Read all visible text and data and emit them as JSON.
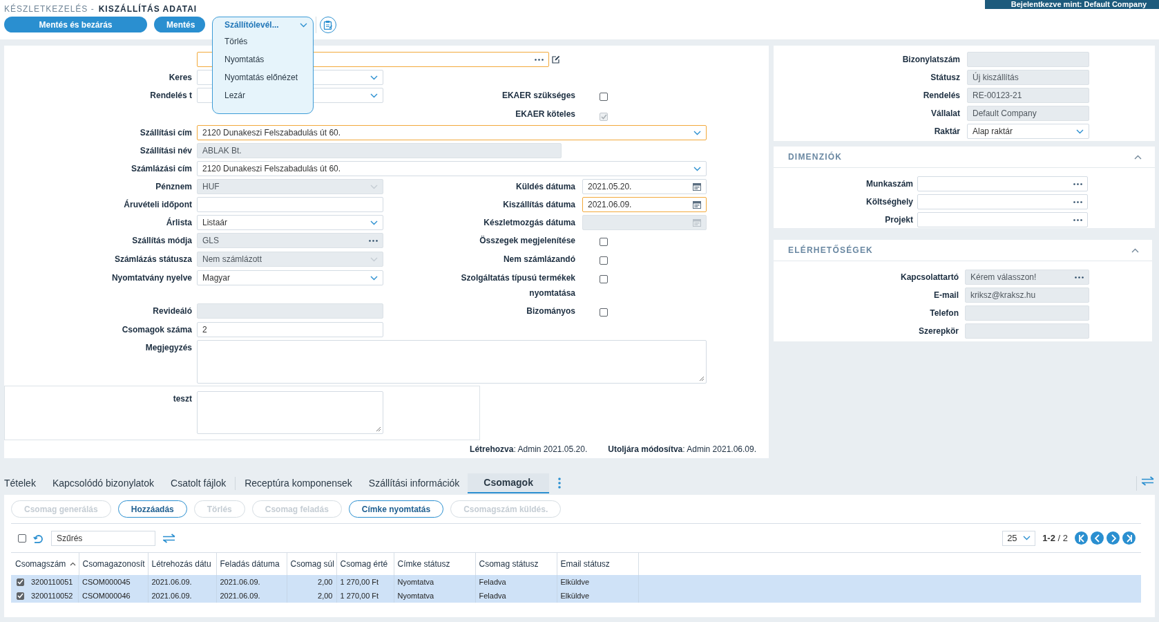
{
  "header": {
    "breadcrumb": "KÉSZLETKEZELÉS -",
    "title": "KISZÁLLÍTÁS ADATAI",
    "login": "Bejelentkezve mint: Default Company"
  },
  "toolbar": {
    "buttons": [
      "Mentés és bezárás",
      "Mentés"
    ],
    "dropdown": {
      "label": "Szállítólevél...",
      "expanded": true,
      "items": [
        "Törlés",
        "Nyomtatás",
        "Nyomtatás előnézet",
        "Lezár"
      ]
    }
  },
  "form": {
    "rows": [
      {
        "full": {
          "kind": "lookup",
          "disabled": false,
          "focused": true,
          "editable": true
        }
      },
      {
        "left": {
          "label": "Keres",
          "kind": "select",
          "disabled": false
        }
      },
      {
        "left": {
          "label": "Rendelés t",
          "kind": "select",
          "disabled": false
        },
        "right": {
          "label": "EKAER szükséges",
          "kind": "checkbox",
          "checked": false,
          "disabled": false
        }
      },
      {
        "right": {
          "label": "EKAER köteles",
          "kind": "checkbox",
          "checked": true,
          "disabled": true
        }
      },
      {
        "full": {
          "label": "Szállítási cím",
          "kind": "select",
          "value": "2120 Dunakeszi Felszabadulás út 60.",
          "disabled": false,
          "focused": true
        }
      },
      {
        "full": {
          "label": "Szállítási név",
          "kind": "text",
          "value": "ABLAK Bt.",
          "disabled": true
        }
      },
      {
        "full": {
          "label": "Számlázási cím",
          "kind": "select",
          "value": "2120 Dunakeszi Felszabadulás út 60.",
          "disabled": false
        }
      },
      {
        "left": {
          "label": "Pénznem",
          "kind": "select",
          "value": "HUF",
          "disabled": true
        },
        "right": {
          "label": "Küldés dátuma",
          "kind": "date",
          "value": "2021.05.20.",
          "disabled": false
        }
      },
      {
        "left": {
          "label": "Áruvételi időpont",
          "kind": "text",
          "disabled": false
        },
        "right": {
          "label": "Kiszállítás dátuma",
          "kind": "date",
          "value": "2021.06.09.",
          "disabled": false,
          "focused": true
        }
      },
      {
        "left": {
          "label": "Árlista",
          "kind": "select",
          "value": "Listaár",
          "disabled": false
        },
        "right": {
          "label": "Készletmozgás dátuma",
          "kind": "date",
          "disabled": true
        }
      },
      {
        "left": {
          "label": "Szállítás módja",
          "kind": "lookup",
          "value": "GLS",
          "disabled": true
        },
        "right": {
          "label": "Összegek megjelenítése",
          "kind": "checkbox",
          "checked": false,
          "disabled": false
        }
      },
      {
        "left": {
          "label": "Számlázás státusza",
          "kind": "select",
          "value": "Nem számlázott",
          "disabled": true
        },
        "right": {
          "label": "Nem számlázandó",
          "kind": "checkbox",
          "checked": false,
          "disabled": false
        }
      },
      {
        "left": {
          "label": "Nyomtatvány nyelve",
          "kind": "select",
          "value": "Magyar",
          "disabled": false
        },
        "right": {
          "label": "Szolgáltatás típusú termékek nyomtatása",
          "kind": "checkbox",
          "checked": false,
          "disabled": false
        }
      },
      {
        "left": {
          "label": "Revideáló",
          "kind": "text",
          "disabled": true
        },
        "right": {
          "label": "Bizományos",
          "kind": "checkbox",
          "checked": false,
          "disabled": false
        }
      },
      {
        "left": {
          "label": "Csomagok száma",
          "kind": "text",
          "value": "2",
          "disabled": false
        }
      },
      {
        "full": {
          "label": "Megjegyzés",
          "kind": "textarea",
          "disabled": false
        }
      }
    ],
    "extra": {
      "label": "teszt",
      "kind": "textarea",
      "disabled": false
    },
    "footer": [
      "**Létrehozva**: Admin 2021.05.20.",
      "**Utoljára módosítva**: Admin 2021.06.09."
    ]
  },
  "details": {
    "fields": [
      {
        "label": "Bizonylatszám",
        "kind": "text",
        "disabled": true
      },
      {
        "label": "Státusz",
        "kind": "text",
        "value": "Új kiszállítás",
        "disabled": true
      },
      {
        "label": "Rendelés",
        "kind": "text",
        "value": "RE-00123-21",
        "disabled": true
      },
      {
        "label": "Vállalat",
        "kind": "text",
        "value": "Default Company",
        "disabled": true
      },
      {
        "label": "Raktár",
        "kind": "select",
        "value": "Alap raktár",
        "disabled": false
      }
    ]
  },
  "sections": [
    {
      "title": "DIMENZIÓK",
      "expanded": true,
      "fields": [
        {
          "label": "Munkaszám",
          "kind": "lookup",
          "disabled": false
        },
        {
          "label": "Költséghely",
          "kind": "lookup",
          "disabled": false
        },
        {
          "label": "Projekt",
          "kind": "lookup",
          "disabled": false
        }
      ]
    },
    {
      "title": "ELÉRHETŐSÉGEK",
      "expanded": true,
      "fields": [
        {
          "label": "Kapcsolattartó",
          "kind": "lookup",
          "value": "Kérem válasszon!",
          "disabled": true
        },
        {
          "label": "E-mail",
          "kind": "text",
          "value": "kriksz@kraksz.hu",
          "disabled": true
        },
        {
          "label": "Telefon",
          "kind": "text",
          "disabled": true
        },
        {
          "label": "Szerepkör",
          "kind": "text",
          "disabled": true
        }
      ]
    }
  ],
  "tabs": [
    {
      "label": "Tételek",
      "selected": false
    },
    {
      "label": "Kapcsolódó bizonylatok",
      "selected": false
    },
    {
      "label": "Csatolt fájlok",
      "selected": false
    },
    {
      "label": "Receptúra komponensek",
      "selected": false,
      "separated": true
    },
    {
      "label": "Szállítási információk",
      "selected": false
    },
    {
      "label": "Csomagok",
      "selected": true
    }
  ],
  "package_actions": [
    {
      "label": "Csomag generálás",
      "disabled": true
    },
    {
      "label": "Hozzáadás",
      "disabled": false
    },
    {
      "label": "Törlés",
      "disabled": true
    },
    {
      "label": "Csomag feladás",
      "disabled": true
    },
    {
      "label": "Címke nyomtatás",
      "disabled": false
    },
    {
      "label": "Csomagszám küldés.",
      "disabled": true
    }
  ],
  "filter": {
    "checked": false,
    "placeholder": "Szűrés"
  },
  "pager": {
    "page_size": "25",
    "range": "**1-2** / 2"
  },
  "table": {
    "columns": [
      {
        "label": "Csomagszám",
        "sorted": true,
        "ascending": true
      },
      {
        "label": "Csomagazonosít"
      },
      {
        "label": "Létrehozás dátu"
      },
      {
        "label": "Feladás dátuma"
      },
      {
        "label": "Csomag súl",
        "numeric": true
      },
      {
        "label": "Csomag érté"
      },
      {
        "label": "Címke státusz"
      },
      {
        "label": "Csomag státusz"
      },
      {
        "label": "Email státusz"
      }
    ],
    "rows": [
      {
        "selected": true,
        "checked": true,
        "cells": [
          "3200110051",
          "CSOM000045",
          "2021.06.09.",
          "2021.06.09.",
          "2,00",
          "1 270,00 Ft",
          "Nyomtatva",
          "Feladva",
          "Elküldve"
        ]
      },
      {
        "selected": true,
        "checked": true,
        "cells": [
          "3200110052",
          "CSOM000046",
          "2021.06.09.",
          "2021.06.09.",
          "2,00",
          "1 270,00 Ft",
          "Nyomtatva",
          "Feladva",
          "Elküldve"
        ]
      }
    ]
  }
}
